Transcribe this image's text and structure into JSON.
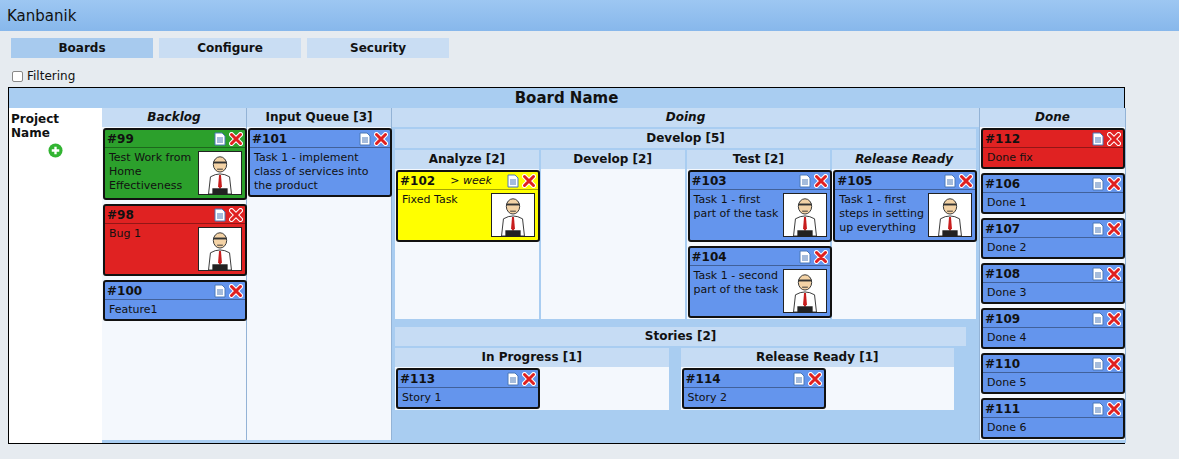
{
  "app": {
    "title": "Kanbanik"
  },
  "tabs": [
    {
      "label": "Boards",
      "selected": true
    },
    {
      "label": "Configure",
      "selected": false
    },
    {
      "label": "Security",
      "selected": false
    }
  ],
  "filtering": {
    "label": "Filtering",
    "checked": false
  },
  "board": {
    "name": "Board Name",
    "project": {
      "name": "Project Name"
    },
    "columns": [
      {
        "title": "Backlog",
        "italic": true,
        "kind": "cards",
        "cards": [
          {
            "id": "#99",
            "text": "Test Work from Home Effectiveness",
            "color": "#2ca02c",
            "avatar": true
          },
          {
            "id": "#98",
            "text": "Bug 1",
            "color": "#e02222",
            "avatar": true
          },
          {
            "id": "#100",
            "text": "Feature1",
            "color": "#6495ed",
            "avatar": false
          }
        ]
      },
      {
        "title": "Input Queue [3]",
        "italic": false,
        "kind": "cards",
        "cards": [
          {
            "id": "#101",
            "text": "Task 1 - implement class of services into the product",
            "color": "#6495ed",
            "avatar": false
          }
        ]
      },
      {
        "title": "Doing",
        "italic": true,
        "kind": "groups",
        "groups": [
          {
            "title": "Develop [5]",
            "italic": false,
            "columns": [
              {
                "title": "Analyze [2]",
                "italic": false,
                "cards": [
                  {
                    "id": "#102",
                    "note": "> week",
                    "text": "Fixed Task",
                    "color": "#ffff00",
                    "avatar": true
                  }
                ]
              },
              {
                "title": "Develop [2]",
                "italic": false,
                "cards": []
              },
              {
                "title": "Test [2]",
                "italic": false,
                "cards": [
                  {
                    "id": "#103",
                    "text": "Task 1 - first part of the task",
                    "color": "#6495ed",
                    "avatar": true
                  },
                  {
                    "id": "#104",
                    "text": "Task 1 - second part of the task",
                    "color": "#6495ed",
                    "avatar": true
                  }
                ]
              },
              {
                "title": "Release Ready",
                "italic": true,
                "cards": [
                  {
                    "id": "#105",
                    "text": "Task 1 - first steps in setting up everything",
                    "color": "#6495ed",
                    "avatar": true
                  }
                ]
              }
            ]
          },
          {
            "title": "Stories [2]",
            "italic": false,
            "columns": [
              {
                "title": "In Progress [1]",
                "italic": false,
                "cards": [
                  {
                    "id": "#113",
                    "text": "Story 1",
                    "color": "#6495ed",
                    "avatar": false
                  }
                ]
              },
              {
                "title": "Release Ready [1]",
                "italic": false,
                "cards": [
                  {
                    "id": "#114",
                    "text": "Story 2",
                    "color": "#6495ed",
                    "avatar": false
                  }
                ]
              }
            ]
          }
        ]
      },
      {
        "title": "Done",
        "italic": true,
        "kind": "cards",
        "cards": [
          {
            "id": "#112",
            "text": "Done fix",
            "color": "#e02222",
            "avatar": false
          },
          {
            "id": "#106",
            "text": "Done 1",
            "color": "#6495ed",
            "avatar": false
          },
          {
            "id": "#107",
            "text": "Done 2",
            "color": "#6495ed",
            "avatar": false
          },
          {
            "id": "#108",
            "text": "Done 3",
            "color": "#6495ed",
            "avatar": false
          },
          {
            "id": "#109",
            "text": "Done 4",
            "color": "#6495ed",
            "avatar": false
          },
          {
            "id": "#110",
            "text": "Done 5",
            "color": "#6495ed",
            "avatar": false
          },
          {
            "id": "#111",
            "text": "Done 6",
            "color": "#6495ed",
            "avatar": false
          }
        ]
      }
    ]
  }
}
